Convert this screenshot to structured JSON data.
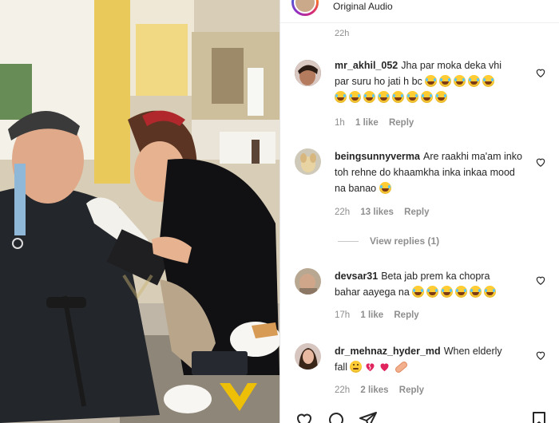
{
  "header": {
    "audio_label": "Original Audio"
  },
  "top_timestamp": "22h",
  "comments": [
    {
      "username": "mr_akhil_052",
      "text_line1": "Jha par moka deka vhi",
      "text_line2": "par suru ho jati h bc",
      "time": "1h",
      "likes": "1 like",
      "reply": "Reply"
    },
    {
      "username": "beingsunnyverma",
      "text": "Are raakhi ma'am inko toh rehne do khaamkha inka inkaa mood na banao",
      "time": "22h",
      "likes": "13 likes",
      "reply": "Reply",
      "view_replies": "View replies (1)"
    },
    {
      "username": "devsar31",
      "text_line1": "Beta jab prem ka chopra",
      "text_line2": "bahar aayega na",
      "time": "17h",
      "likes": "1 like",
      "reply": "Reply"
    },
    {
      "username": "dr_mehnaz_hyder_md",
      "text_line1": "When elderly",
      "text_line2": "fall",
      "time": "22h",
      "likes": "2 likes",
      "reply": "Reply"
    }
  ],
  "icons": [
    "heart-icon",
    "comment-icon",
    "share-icon",
    "bookmark-icon"
  ],
  "colors": {
    "text": "#262626",
    "muted": "#8e8e8e",
    "heart_red": "#e0245e",
    "emoji": "#ffcc33"
  }
}
